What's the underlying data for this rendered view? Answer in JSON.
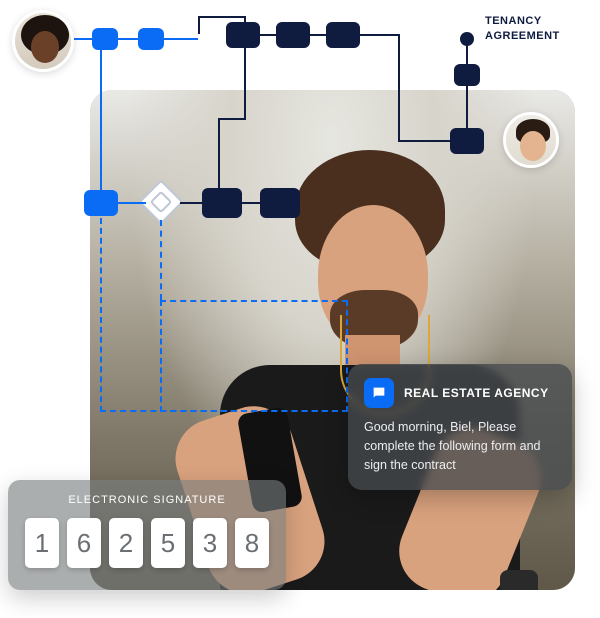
{
  "labels": {
    "tenancy_line1": "TENANCY",
    "tenancy_line2": "AGREEMENT"
  },
  "notification": {
    "sender": "REAL ESTATE AGENCY",
    "message": "Good morning, Biel, Please complete the following form and sign the contract"
  },
  "signature": {
    "label": "ELECTRONIC SIGNATURE",
    "digits": [
      "1",
      "6",
      "2",
      "5",
      "3",
      "8"
    ]
  }
}
